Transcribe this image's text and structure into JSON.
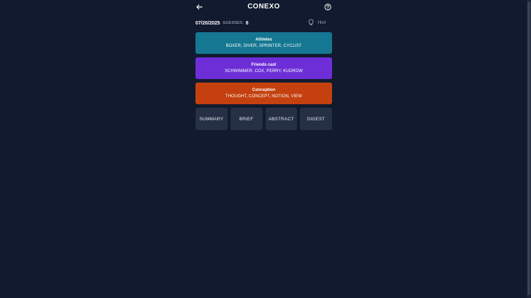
{
  "header": {
    "title": "CONEXO",
    "back_icon": "arrow-left-icon",
    "help_icon": "question-circle-icon"
  },
  "status": {
    "date": "07/20/2025",
    "guesses_label": "GUESSES:",
    "guesses_count": "8",
    "hint_label": "Hint",
    "hint_icon": "lightbulb-icon"
  },
  "groups": [
    {
      "name": "Athletes",
      "words": "BOXER, DIVER, SPRINTER, CYCLIST",
      "color": "#157791"
    },
    {
      "name": "Friends cast",
      "words": "SCHWIMMER, COX, PERRY, KUDROW",
      "color": "#6d2ed8"
    },
    {
      "name": "Conception",
      "words": "THOUGHT, CONCEPT, NOTION, VIEW",
      "color": "#c4410f"
    }
  ],
  "tiles": [
    "SUMMARY",
    "BRIEF",
    "ABSTRACT",
    "DIGEST"
  ],
  "colors": {
    "background": "#111a2e",
    "tile": "#253045"
  }
}
